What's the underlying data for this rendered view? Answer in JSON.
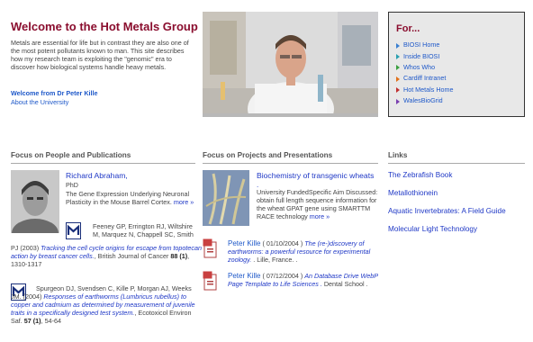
{
  "intro": {
    "title": "Welcome to the Hot Metals Group",
    "text": "Metals are essential for life but in contrast they are also one of the most potent pollutants known to man. This site describes how my research team is exploiting the \"genomic\" era to discover how biological systems handle heavy metals.",
    "welcome_link": "Welcome from Dr Peter Kille",
    "about_link": "About the University"
  },
  "for_box": {
    "title": "For...",
    "items": [
      {
        "label": "BIOSI Home",
        "color": "#3a7fd0"
      },
      {
        "label": "Inside BIOSI",
        "color": "#2aa0b0"
      },
      {
        "label": "Whos Who",
        "color": "#3aa040"
      },
      {
        "label": "Cardiff Intranet",
        "color": "#e0701a"
      },
      {
        "label": "Hot Metals Home",
        "color": "#c03030"
      },
      {
        "label": "WalesBioGrid",
        "color": "#7a3fb0"
      }
    ]
  },
  "sections": {
    "people": "Focus on People and Publications",
    "projects": "Focus on Projects and Presentations",
    "links": "Links"
  },
  "person": {
    "name": "Richard Abraham,",
    "role": "PhD",
    "description": "The Gene Expression Underlying Neuronal Plasticity in the Mouse Barrel Cortex.",
    "more": "more »"
  },
  "pub1": {
    "authors": "Feeney GP, Errington RJ, Wiltshire M, Marquez N, Chappell SC, Smith",
    "prefix": "PJ (2003)",
    "title": "Tracking the cell cycle origins for escape from topotecan action by breast cancer cells.",
    "journal": ", British Journal of Cancer",
    "volume": "88 (1)",
    "pages": ", 1310-1317"
  },
  "pub2": {
    "authors": "Spurgeon DJ, Svendsen C, Kille P, Morgan AJ, Weeks JM. (2004)",
    "title": "Responses of earthworms (Lumbricus rubellus) to copper and cadmium as determined by measurement of juvenile traits in a specifically designed test system.",
    "journal": ", Ecotoxicol Environ Saf.",
    "volume": "57 (1)",
    "pages": ", 54-64"
  },
  "project": {
    "title": "Biochemistry of transgenic wheats",
    "dot": ".",
    "description": "University FundedSpecific Aim Discussed: obtain full length sequence information for the wheat GPAT gene using SMARTTM RACE technology",
    "more": "more »"
  },
  "news": [
    {
      "author": "Peter Kille",
      "date": " ( 01/10/2004 ) ",
      "title": "The (re-)discovery of earthworms: a powerful resource for experimental zoology.",
      "place": " . Lille, France. ."
    },
    {
      "author": "Peter Kille",
      "date": " ( 07/12/2004 ) ",
      "title": "An Database Drive WebP Page Template to Life Sciences .",
      "place": " Dental School ."
    }
  ],
  "links": [
    "The Zebrafish Book",
    "Metallothionein",
    "Aquatic Invertebrates: A Field Guide",
    "Molecular Light Technology"
  ]
}
